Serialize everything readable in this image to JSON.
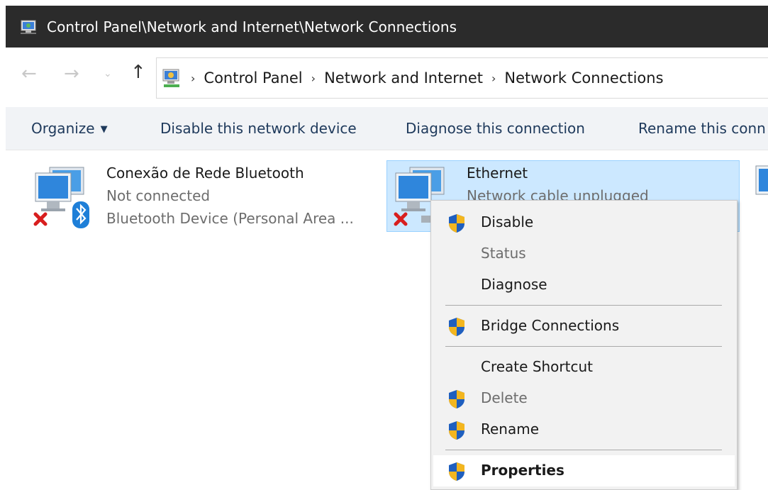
{
  "window": {
    "title": "Control Panel\\Network and Internet\\Network Connections"
  },
  "address": {
    "back_glyph": "←",
    "forward_glyph": "→",
    "up_glyph": "↑",
    "breadcrumb": [
      "Control Panel",
      "Network and Internet",
      "Network Connections"
    ]
  },
  "commands": {
    "organize": "Organize",
    "disable": "Disable this network device",
    "diagnose": "Diagnose this connection",
    "rename": "Rename this conn"
  },
  "connections": [
    {
      "name": "Conexão de Rede Bluetooth",
      "status": "Not connected",
      "device": "Bluetooth Device (Personal Area ...",
      "icon": "bluetooth-network-icon"
    },
    {
      "name": "Ethernet",
      "status": "Network cable unplugged",
      "device": "",
      "icon": "ethernet-network-icon",
      "selected": true
    }
  ],
  "context_menu": {
    "items": [
      {
        "label": "Disable",
        "shield": true,
        "disabled": false
      },
      {
        "label": "Status",
        "shield": false,
        "disabled": true
      },
      {
        "label": "Diagnose",
        "shield": false,
        "disabled": false
      },
      {
        "label": "Bridge Connections",
        "shield": true,
        "disabled": false
      },
      {
        "label": "Create Shortcut",
        "shield": false,
        "disabled": false
      },
      {
        "label": "Delete",
        "shield": true,
        "disabled": true
      },
      {
        "label": "Rename",
        "shield": true,
        "disabled": false
      },
      {
        "label": "Properties",
        "shield": true,
        "disabled": false,
        "bold": true,
        "highlighted": true
      }
    ]
  },
  "colors": {
    "titlebar": "#2b2b2b",
    "command_text": "#1e395b",
    "selection_fill": "#cce8ff",
    "selection_border": "#99d1ff",
    "menu_bg": "#f2f2f2"
  }
}
